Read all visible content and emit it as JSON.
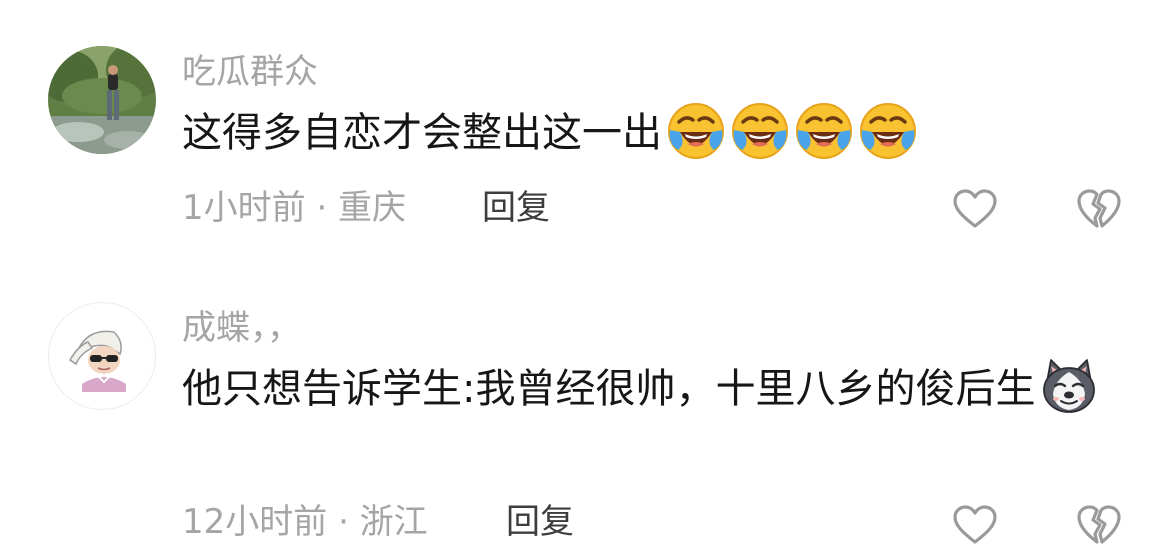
{
  "comments": [
    {
      "username": "吃瓜群众",
      "text": "这得多自恋才会整出这一出",
      "emojis": [
        "laughing-crying-emoji",
        "laughing-crying-emoji",
        "laughing-crying-emoji",
        "laughing-crying-emoji"
      ],
      "meta": "1小时前 · 重庆",
      "reply_label": "回复",
      "like_icon": "heart-outline-icon",
      "dislike_icon": "broken-heart-icon"
    },
    {
      "username": "成蝶，，",
      "text": "他只想告诉学生:我曾经很帅，十里八乡的俊后生",
      "emojis": [
        "husky-dog-emoji"
      ],
      "meta": "12小时前 · 浙江",
      "reply_label": "回复",
      "like_icon": "heart-outline-icon",
      "dislike_icon": "broken-heart-icon"
    }
  ],
  "colors": {
    "secondary_text": "#a5a5a5",
    "primary_text": "#161616",
    "reply_text": "#3d3d3d",
    "icon_gray": "#9a9a9a"
  }
}
